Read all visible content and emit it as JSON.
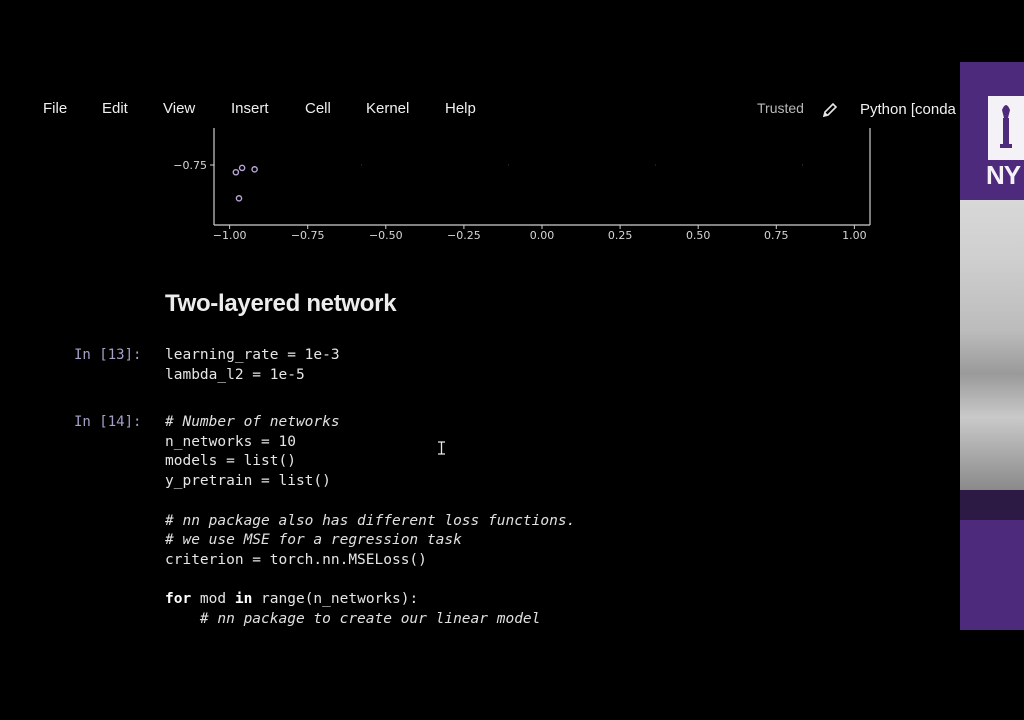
{
  "menu": {
    "items": [
      "File",
      "Edit",
      "View",
      "Insert",
      "Cell",
      "Kernel",
      "Help"
    ]
  },
  "status": {
    "trusted": "Trusted",
    "kernel": "Python [conda"
  },
  "chart_data": {
    "type": "scatter",
    "title": "",
    "xlabel": "",
    "ylabel": "",
    "xlim": [
      -1.05,
      1.05
    ],
    "x_ticks": [
      "−1.00",
      "−0.75",
      "−0.50",
      "−0.25",
      "0.00",
      "0.25",
      "0.50",
      "0.75",
      "1.00"
    ],
    "y_ticks": [
      "−0.75"
    ],
    "grid": true,
    "points": [
      {
        "x": -0.98,
        "y": -0.8
      },
      {
        "x": -0.96,
        "y": -0.77
      },
      {
        "x": -0.92,
        "y": -0.78
      },
      {
        "x": -0.97,
        "y": -0.98
      }
    ],
    "point_color": "#b9a6d6"
  },
  "notebook": {
    "heading": "Two-layered network",
    "cells": [
      {
        "prompt": "In [13]:",
        "lines": [
          "learning_rate = 1e-3",
          "lambda_l2 = 1e-5"
        ]
      },
      {
        "prompt": "In [14]:",
        "lines": [
          "# Number of networks",
          "n_networks = 10",
          "models = list()",
          "y_pretrain = list()",
          "",
          "# nn package also has different loss functions.",
          "# we use MSE for a regression task",
          "criterion = torch.nn.MSELoss()",
          "",
          "for mod in range(n_networks):",
          "    # nn package to create our linear model"
        ]
      }
    ]
  },
  "sidebar": {
    "logo_text": "NY",
    "brand_color": "#4d2a7c"
  }
}
